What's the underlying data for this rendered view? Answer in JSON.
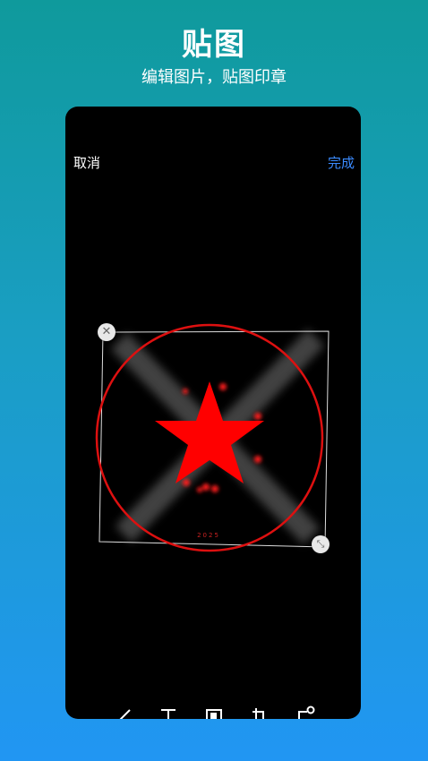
{
  "header": {
    "title": "贴图",
    "subtitle": "编辑图片，贴图印章"
  },
  "editor": {
    "cancel_label": "取消",
    "done_label": "完成",
    "stamp_text": "2025",
    "colors": {
      "accent": "#3b8bff",
      "stamp_red": "#ff0000",
      "background": "#000000"
    }
  },
  "icons": {
    "close": "close-icon",
    "resize": "resize-icon",
    "tools": [
      "brush-icon",
      "text-icon",
      "mosaic-icon",
      "crop-icon",
      "sticker-icon"
    ]
  }
}
